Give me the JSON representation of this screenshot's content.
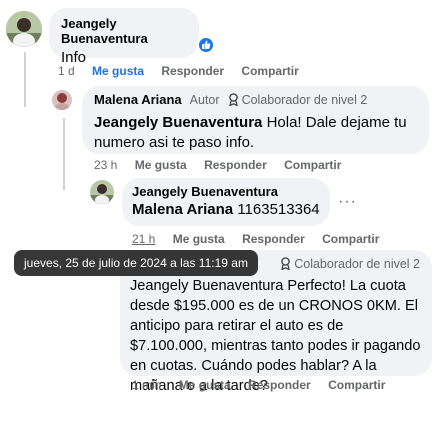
{
  "comments": [
    {
      "author": "Jeangely Buenaventura",
      "text": "Info",
      "time": "1 d",
      "like_label": "Me gusta",
      "reply_label": "Responder",
      "share_label": "Compartir",
      "reaction": "like-icon"
    },
    {
      "author": "Malena Ariana",
      "author_tag": "Autor",
      "badge": "Colaborador de nivel 2",
      "mention": "Jeangely Buenaventura",
      "text": " Hola! Dale dejame tu numero asi te paso info.",
      "time": "23 h",
      "like_label": "Me gusta",
      "reply_label": "Responder",
      "share_label": "Compartir"
    },
    {
      "author": "Jeangely Buenaventura",
      "mention": "Malena Ariana",
      "text": " 1163513364",
      "time": "21 h",
      "like_label": "Me gusta",
      "reply_label": "Responder",
      "share_label": "Compartir",
      "more": "···"
    },
    {
      "badge": "Colaborador de nivel 2",
      "mention": "Jeangely Buenaventura",
      "text": " Perfecto! La cuota desde $195.000 es de un CRONOS 0KM. El anticipo para retirar el auto es de $7.100.000, mientras tanto podes ir pagando en cuotas. Cuándo podes hablar? A la mañana o a la tarde?",
      "time": "1 min",
      "like_label": "Me gusta",
      "reply_label": "Responder",
      "share_label": "Compartir"
    }
  ],
  "tooltip": "jueves, 25 de julio de 2024 a las 11:19 am",
  "colors": {
    "like_blue": "#1b74e4",
    "bubble_bg": "#f0f2f5",
    "meta_gray": "#65676b"
  }
}
